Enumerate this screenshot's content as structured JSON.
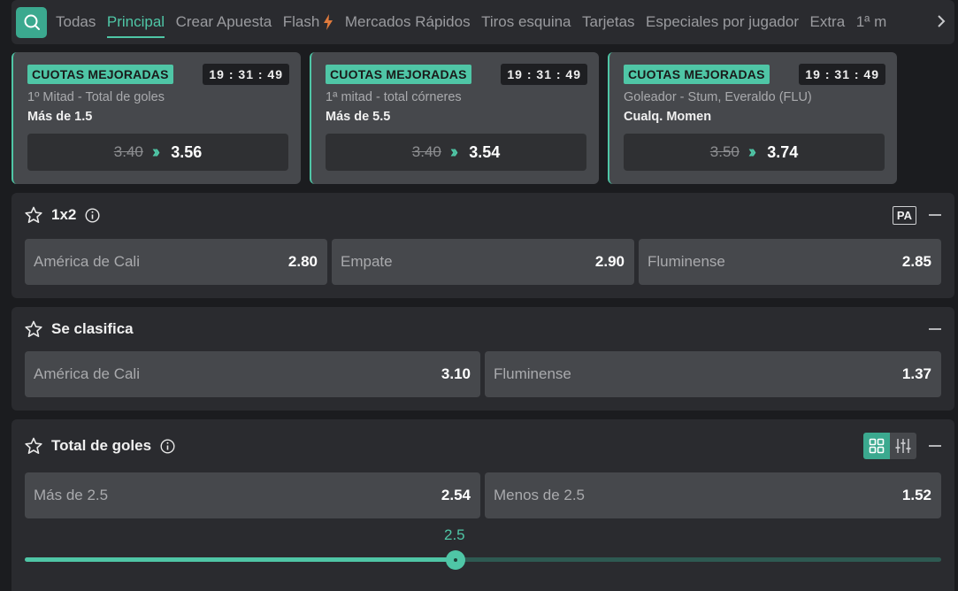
{
  "nav": {
    "tabs": [
      "Todas",
      "Principal",
      "Crear Apuesta",
      "Flash",
      "Mercados Rápidos",
      "Tiros esquina",
      "Tarjetas",
      "Especiales por jugador",
      "Extra",
      "1ª m"
    ],
    "active_tab": "Principal",
    "icons": {
      "search": "search-icon",
      "flash": "lightning-icon",
      "next": "chevron-right-icon"
    }
  },
  "boosted": [
    {
      "badge": "CUOTAS MEJORADAS",
      "timer": "19 : 31 : 49",
      "market": "1º Mitad - Total de goles",
      "selection": "Más de 1.5",
      "old_odd": "3.40",
      "new_odd": "3.56"
    },
    {
      "badge": "CUOTAS MEJORADAS",
      "timer": "19 : 31 : 49",
      "market": "1ª mitad - total córneres",
      "selection": "Más de 5.5",
      "old_odd": "3.40",
      "new_odd": "3.54"
    },
    {
      "badge": "CUOTAS MEJORADAS",
      "timer": "19 : 31 : 49",
      "market": "Goleador - Stum, Everaldo (FLU)",
      "selection": "Cualq. Momen",
      "old_odd": "3.50",
      "new_odd": "3.74"
    }
  ],
  "markets": {
    "m1x2": {
      "title": "1x2",
      "pa_label": "PA",
      "options": [
        {
          "label": "América de Cali",
          "odd": "2.80"
        },
        {
          "label": "Empate",
          "odd": "2.90"
        },
        {
          "label": "Fluminense",
          "odd": "2.85"
        }
      ]
    },
    "clasifica": {
      "title": "Se clasifica",
      "options": [
        {
          "label": "América de Cali",
          "odd": "3.10"
        },
        {
          "label": "Fluminense",
          "odd": "1.37"
        }
      ]
    },
    "goles": {
      "title": "Total de goles",
      "options": [
        {
          "label": "Más de 2.5",
          "odd": "2.54"
        },
        {
          "label": "Menos de 2.5",
          "odd": "1.52"
        }
      ],
      "slider_label": "2.5",
      "slider_fraction": 0.47
    }
  },
  "colors": {
    "accent": "#4fc6a6",
    "panel": "#2a2b2f",
    "button": "#46484c",
    "background": "#1b1c1f"
  }
}
